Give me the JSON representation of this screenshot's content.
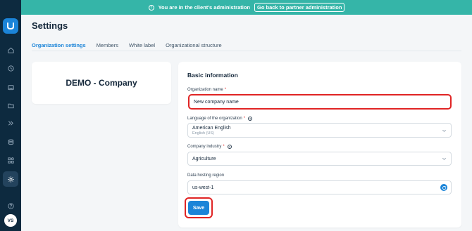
{
  "banner": {
    "message": "You are in the client's administration",
    "back_button": "Go back to partner administration"
  },
  "sidebar": {
    "items": [
      "home-icon",
      "clock-icon",
      "inbox-icon",
      "folder-icon",
      "chevrons-icon",
      "database-icon",
      "apps-icon",
      "gear-icon"
    ],
    "active": "gear-icon",
    "help_icon": "question-icon",
    "avatar": "VS"
  },
  "page": {
    "title": "Settings"
  },
  "tabs": [
    {
      "label": "Organization settings",
      "active": true
    },
    {
      "label": "Members",
      "active": false
    },
    {
      "label": "White label",
      "active": false
    },
    {
      "label": "Organizational structure",
      "active": false
    }
  ],
  "company_card": {
    "name": "DEMO - Company"
  },
  "form": {
    "section_title": "Basic information",
    "org_name": {
      "label": "Organization name",
      "required": "*",
      "value": "New company name"
    },
    "language": {
      "label": "Language of the organization",
      "required": "*",
      "value": "American English",
      "sub": "English (US)"
    },
    "industry": {
      "label": "Company industry",
      "required": "*",
      "value": "Agriculture"
    },
    "hosting": {
      "label": "Data hosting region",
      "value": "us-west-1"
    },
    "save_label": "Save"
  },
  "colors": {
    "banner": "#35b5a8",
    "sidebar": "#0d2a3f",
    "accent": "#1b84d8",
    "highlight": "#e02424"
  }
}
